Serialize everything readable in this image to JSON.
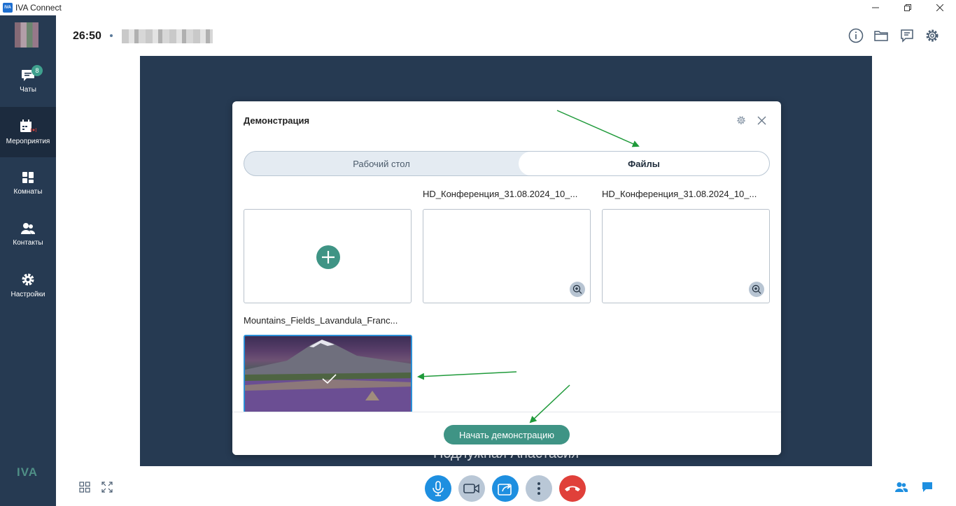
{
  "window": {
    "app_name": "IVA Connect",
    "logo_text": "IVA"
  },
  "sidebar": {
    "items": [
      {
        "label": "Чаты",
        "badge": "8"
      },
      {
        "label": "Мероприятия"
      },
      {
        "label": "Комнаты"
      },
      {
        "label": "Контакты"
      },
      {
        "label": "Настройки"
      }
    ],
    "bottom_logo": "IVA"
  },
  "topbar": {
    "timer": "26:50"
  },
  "stage": {
    "participant_name": "Подлужная Анастасия"
  },
  "modal": {
    "title": "Демонстрация",
    "tabs": [
      "Рабочий стол",
      "Файлы"
    ],
    "active_tab": "Файлы",
    "files": [
      {
        "label": "HD_Конференция_31.08.2024_10_..."
      },
      {
        "label": "HD_Конференция_31.08.2024_10_..."
      },
      {
        "label": "Mountains_Fields_Lavandula_Franc...",
        "selected": true
      }
    ],
    "start_button": "Начать демонстрацию"
  },
  "colors": {
    "sidebar_bg": "#263a52",
    "accent_green": "#3f9485",
    "hangup_red": "#e0403a",
    "control_blue": "#1e8fe0",
    "annotation_arrow": "#1f9a3a"
  }
}
